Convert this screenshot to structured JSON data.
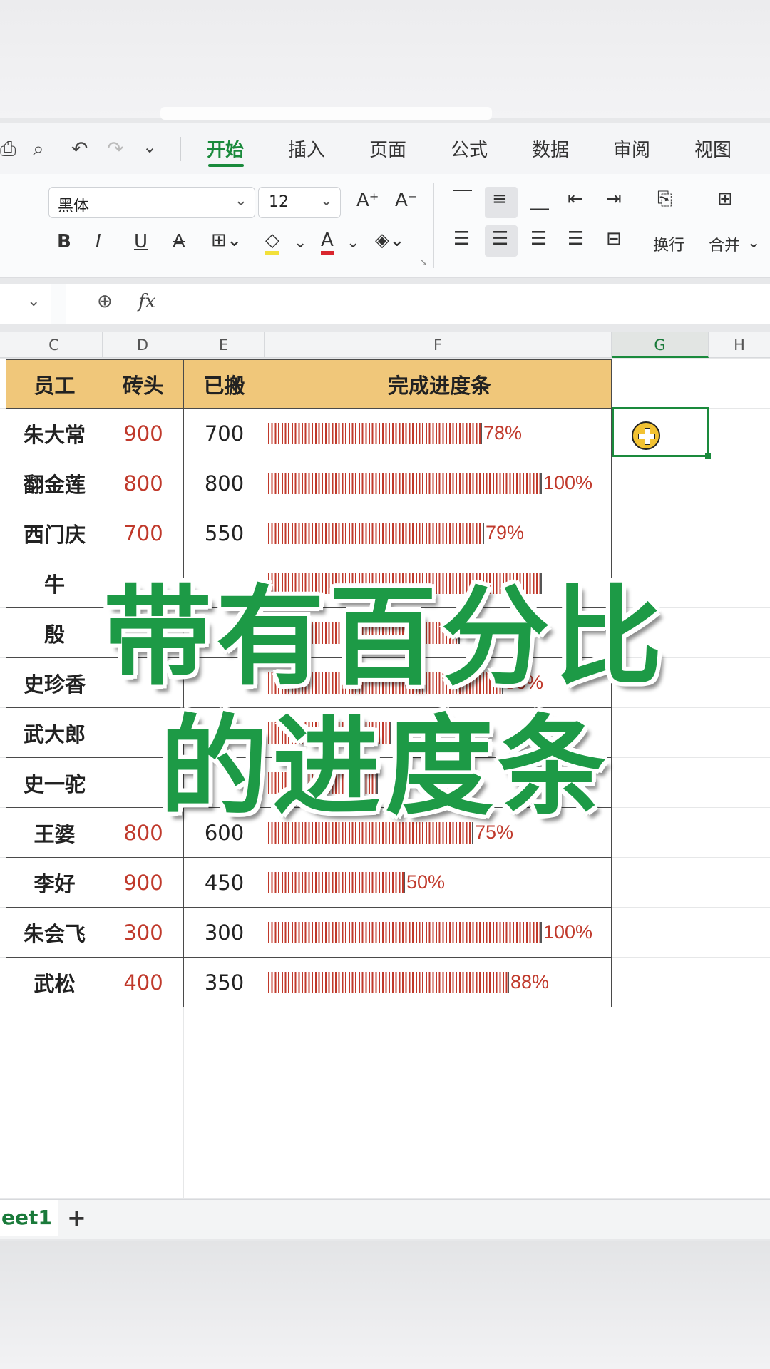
{
  "toolbar": {
    "tabs": [
      "开始",
      "插入",
      "页面",
      "公式",
      "数据",
      "审阅",
      "视图"
    ],
    "active_tab": "开始"
  },
  "ribbon": {
    "font_name": "黑体",
    "font_size": "12",
    "wrap_label": "换行",
    "merge_label": "合并"
  },
  "formula_bar": {
    "fx_label": "fx",
    "value": ""
  },
  "columns": [
    "C",
    "D",
    "E",
    "F",
    "G",
    "H"
  ],
  "selected_column": "G",
  "table": {
    "headers": [
      "员工",
      "砖头",
      "已搬",
      "完成进度条"
    ],
    "rows": [
      {
        "name": "朱大常",
        "bricks": "900",
        "moved": "700",
        "progress": 0.78,
        "pct": "78%"
      },
      {
        "name": "翻金莲",
        "bricks": "800",
        "moved": "800",
        "progress": 1.0,
        "pct": "100%"
      },
      {
        "name": "西门庆",
        "bricks": "700",
        "moved": "550",
        "progress": 0.79,
        "pct": "79%"
      },
      {
        "name": "牛",
        "bricks": "",
        "moved": "",
        "progress": 1.0,
        "pct": ""
      },
      {
        "name": "殷",
        "bricks": "",
        "moved": "",
        "progress": 0.7,
        "pct": ""
      },
      {
        "name": "史珍香",
        "bricks": "",
        "moved": "",
        "progress": 0.86,
        "pct": "86%"
      },
      {
        "name": "武大郎",
        "bricks": "",
        "moved": "",
        "progress": 0.45,
        "pct": ""
      },
      {
        "name": "史一驼",
        "bricks": "",
        "moved": "",
        "progress": 0.4,
        "pct": ""
      },
      {
        "name": "王婆",
        "bricks": "800",
        "moved": "600",
        "progress": 0.75,
        "pct": "75%"
      },
      {
        "name": "李好",
        "bricks": "900",
        "moved": "450",
        "progress": 0.5,
        "pct": "50%"
      },
      {
        "name": "朱会飞",
        "bricks": "300",
        "moved": "300",
        "progress": 1.0,
        "pct": "100%"
      },
      {
        "name": "武松",
        "bricks": "400",
        "moved": "350",
        "progress": 0.88,
        "pct": "88%"
      }
    ]
  },
  "sheet_tab": "eet1",
  "add_sheet": "+",
  "overlay": {
    "line1": "带有百分比",
    "line2": "的进度条"
  },
  "colors": {
    "accent": "#1a8a3c",
    "header_fill": "#f0c77a",
    "bar": "#c0392b",
    "overlay_text": "#1d9a46"
  }
}
